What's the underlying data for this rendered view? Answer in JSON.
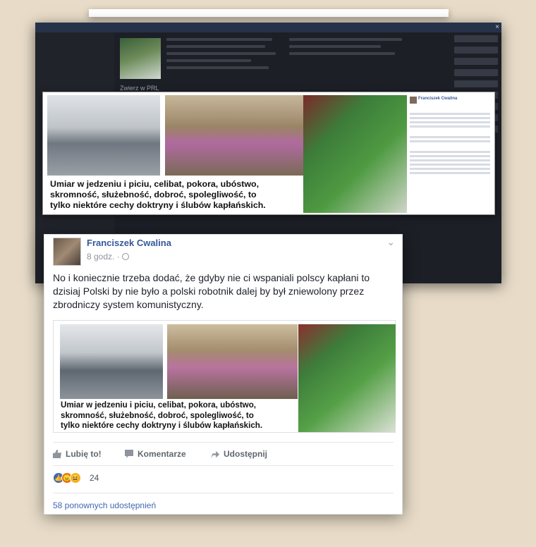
{
  "background_color": "#e8dcc8",
  "overlay": {
    "caption_lines": [
      "Umiar w jedzeniu i piciu, celibat, pokora, ubóstwo,",
      "skromność, służebność, dobroć, spolegliwość, to",
      "tylko niektóre cechy doktryny i ślubów kapłańskich."
    ],
    "side_author": "Franciszek Cwalina"
  },
  "dark_screenshot": {
    "close_icon": "×",
    "thumb_label": "Zwierz w PRL"
  },
  "post": {
    "author": "Franciszek Cwalina",
    "time": "8 godz. ·",
    "text": "No i koniecznie trzeba dodać, że gdyby nie ci wspaniali polscy kapłani to dzisiaj Polski by nie było a polski robotnik dalej by był zniewolony przez zbrodniczy system komunistyczny.",
    "image_caption_lines": [
      "Umiar w jedzeniu i piciu, celibat, pokora, ubóstwo,",
      "skromność, służebność, dobroć, spolegliwość, to",
      "tylko niektóre cechy doktryny i ślubów kapłańskich."
    ],
    "actions": {
      "like": "Lubię to!",
      "comment": "Komentarze",
      "share": "Udostępnij"
    },
    "reactions": {
      "icons": [
        "like-icon",
        "angry-icon",
        "haha-icon"
      ],
      "count": "24"
    },
    "shares": "58 ponownych udostępnień",
    "accent_color": "#365899"
  }
}
